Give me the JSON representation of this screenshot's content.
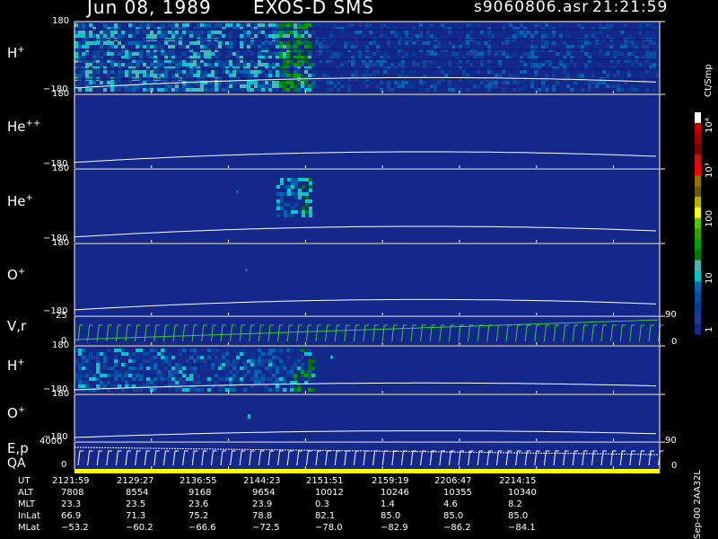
{
  "header": {
    "date": "Jun 08, 1989",
    "mission": "EXOS-D SMS",
    "file": "s9060806.asr",
    "time": "21:21:59"
  },
  "panels": [
    {
      "id": "h1",
      "ion": "H",
      "charge": "+",
      "ymax": "180",
      "ymin": "−180"
    },
    {
      "id": "he2",
      "ion": "He",
      "charge": "++",
      "ymax": "180",
      "ymin": "−180"
    },
    {
      "id": "he1",
      "ion": "He",
      "charge": "+",
      "ymax": "180",
      "ymin": "−180"
    },
    {
      "id": "o1",
      "ion": "O",
      "charge": "+",
      "ymax": "180",
      "ymin": "−180"
    },
    {
      "id": "vr",
      "ion": "V,r",
      "charge": "",
      "ymax": "25",
      "ymin": "0"
    },
    {
      "id": "h2",
      "ion": "H",
      "charge": "+",
      "ymax": "180",
      "ymin": "−180"
    },
    {
      "id": "o2",
      "ion": "O",
      "charge": "+",
      "ymax": "180",
      "ymin": "−180"
    },
    {
      "id": "ep",
      "ion": "E,p",
      "charge": "",
      "ymax": "4000",
      "ymin": "0"
    }
  ],
  "qa_label": "QA",
  "right_axis": {
    "vr": {
      "top": "90",
      "bottom": "0"
    },
    "ep": {
      "top": "90",
      "bottom": "0"
    }
  },
  "colorbar": {
    "unit": "Ct/Smp",
    "tick_labels": [
      "10⁴",
      "10³",
      "100",
      "10",
      "1"
    ],
    "colors": [
      "#ffffff",
      "#c80000",
      "#a00000",
      "#780000",
      "#c81414",
      "#ff0000",
      "#8c7800",
      "#645a00",
      "#b4b400",
      "#ffff00",
      "#50c800",
      "#32a000",
      "#00a000",
      "#007800",
      "#50b4b4",
      "#00c8c8",
      "#0064b4",
      "#0050a0",
      "#003c96",
      "#1e3c96",
      "#14288c"
    ]
  },
  "footer_label": "Sep-00  2AA32L",
  "table": {
    "rows": [
      {
        "label": "UT",
        "values": [
          "2121:59",
          "2129:27",
          "2136:55",
          "2144:23",
          "2151:51",
          "2159:19",
          "2206:47",
          "2214:15"
        ]
      },
      {
        "label": "ALT",
        "values": [
          "7808",
          "8554",
          "9168",
          "9654",
          "10012",
          "10246",
          "10355",
          "10340"
        ]
      },
      {
        "label": "MLT",
        "values": [
          "23.3",
          "23.5",
          "23.6",
          "23.9",
          "0.3",
          "1.4",
          "4.6",
          "8.2"
        ]
      },
      {
        "label": "InLat",
        "values": [
          "66.9",
          "71.3",
          "75.2",
          "78.8",
          "82.1",
          "85.0",
          "85.0",
          "85.0"
        ]
      },
      {
        "label": "MLat",
        "values": [
          "−53.2",
          "−60.2",
          "−66.6",
          "−72.5",
          "−78.0",
          "−82.9",
          "−86.2",
          "−84.1"
        ]
      }
    ]
  },
  "chart_data": {
    "type": "heatmap",
    "title": "Jun 08, 1989   EXOS-D SMS",
    "x_time_ticks": [
      "2121:59",
      "2129:27",
      "2136:55",
      "2144:23",
      "2151:51",
      "2159:19",
      "2206:47",
      "2214:15"
    ],
    "series": [
      {
        "name": "H+",
        "ylim": [
          -180,
          180
        ],
        "activity": "high, spread across pass until ~2146"
      },
      {
        "name": "He++",
        "ylim": [
          -180,
          180
        ],
        "activity": "none"
      },
      {
        "name": "He+",
        "ylim": [
          -180,
          180
        ],
        "activity": "burst near 2144"
      },
      {
        "name": "O+",
        "ylim": [
          -180,
          180
        ],
        "activity": "none"
      },
      {
        "name": "V,r",
        "ylim": [
          0,
          25
        ],
        "activity": "sawtooth sweep"
      },
      {
        "name": "H+",
        "ylim": [
          -180,
          180
        ],
        "activity": "moderate until ~2147"
      },
      {
        "name": "O+",
        "ylim": [
          -180,
          180
        ],
        "activity": "single point near 2141"
      },
      {
        "name": "E,p",
        "ylim": [
          0,
          4000
        ],
        "activity": "sawtooth sweep"
      }
    ],
    "colorbar_scale": "log",
    "colorbar_range": [
      1,
      10000
    ]
  }
}
